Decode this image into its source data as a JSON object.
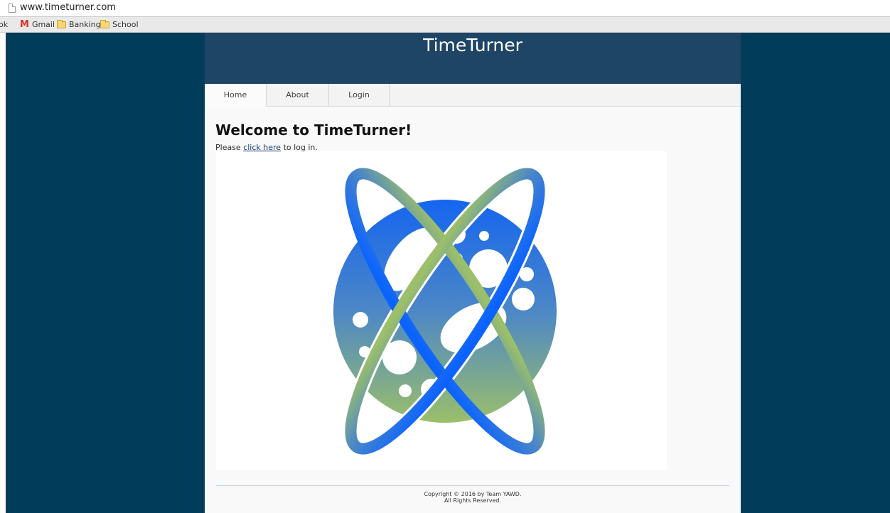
{
  "browser": {
    "url": "www.timeturner.com",
    "bookmarks": [
      {
        "label": "ok",
        "icon": "none"
      },
      {
        "label": "Gmail",
        "icon": "gmail-icon"
      },
      {
        "label": "Banking",
        "icon": "folder-icon"
      },
      {
        "label": "School",
        "icon": "folder-icon"
      }
    ]
  },
  "site": {
    "title": "TimeTurner",
    "nav": [
      {
        "label": "Home",
        "active": true
      },
      {
        "label": "About",
        "active": false
      },
      {
        "label": "Login",
        "active": false
      }
    ],
    "heading": "Welcome to TimeTurner!",
    "intro": {
      "before": "Please ",
      "link": "click here",
      "after": " to log in."
    },
    "footer": {
      "line1": "Copyright © 2016 by Team YAWD.",
      "line2": "All Rights Reserved."
    }
  },
  "colors": {
    "outer_background": "#013d5a",
    "header_background": "#1e4466",
    "logo_blue": "#1565f0",
    "logo_green": "#9bbf6a"
  }
}
